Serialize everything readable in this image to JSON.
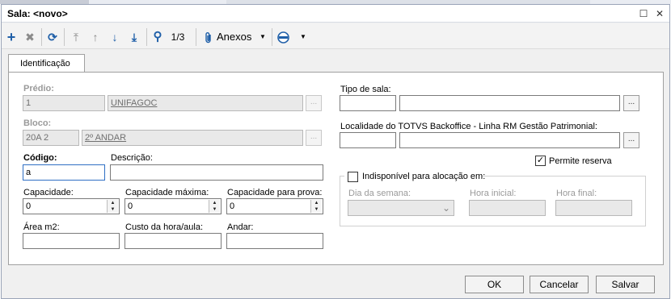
{
  "dialog": {
    "title": "Sala: <novo>",
    "maximize_glyph": "☐",
    "close_glyph": "✕"
  },
  "toolbar": {
    "add_icon": "+",
    "delete_icon": "✖",
    "refresh_icon": "⟳",
    "first_icon": "⤒",
    "prev_icon": "↑",
    "next_icon": "↓",
    "last_icon": "⤓",
    "search_icon": "⚲",
    "record_counter": "1/3",
    "attachments_label": "Anexos",
    "dropdown_glyph": "▼"
  },
  "tabs": [
    {
      "label": "Identificação"
    }
  ],
  "form": {
    "predio": {
      "label": "Prédio:",
      "code": "1",
      "name": "UNIFAGOC"
    },
    "bloco": {
      "label": "Bloco:",
      "code": "20A 2",
      "name": "2º ANDAR"
    },
    "codigo": {
      "label": "Código:",
      "value": "a"
    },
    "descricao": {
      "label": "Descrição:",
      "value": ""
    },
    "capacidade": {
      "label": "Capacidade:",
      "value": "0"
    },
    "capacidade_maxima": {
      "label": "Capacidade máxima:",
      "value": "0"
    },
    "capacidade_prova": {
      "label": "Capacidade para prova:",
      "value": "0"
    },
    "area": {
      "label": "Área m2:",
      "value": ""
    },
    "custo_hora": {
      "label": "Custo da hora/aula:",
      "value": ""
    },
    "andar": {
      "label": "Andar:",
      "value": ""
    },
    "tipo_sala": {
      "label": "Tipo de sala:",
      "code": "",
      "name": ""
    },
    "localidade": {
      "label": "Localidade do TOTVS Backoffice - Linha RM Gestão Patrimonial:",
      "code": "",
      "name": ""
    },
    "permite_reserva": {
      "label": "Permite reserva",
      "checked": true,
      "check_glyph": "✓"
    },
    "indisponivel": {
      "label": "Indisponível para alocação em:",
      "checked": false,
      "dia_semana": {
        "label": "Dia da semana:",
        "value": ""
      },
      "hora_inicial": {
        "label": "Hora inicial:",
        "value": ""
      },
      "hora_final": {
        "label": "Hora final:",
        "value": ""
      }
    },
    "lookup_glyph": "...",
    "spin_up": "▲",
    "spin_down": "▼",
    "combo_glyph": "⌄"
  },
  "buttons": {
    "ok": "OK",
    "cancelar": "Cancelar",
    "salvar": "Salvar"
  },
  "colors": {
    "accent_blue": "#1f5fa8",
    "focus_border": "#2f6fc4"
  }
}
